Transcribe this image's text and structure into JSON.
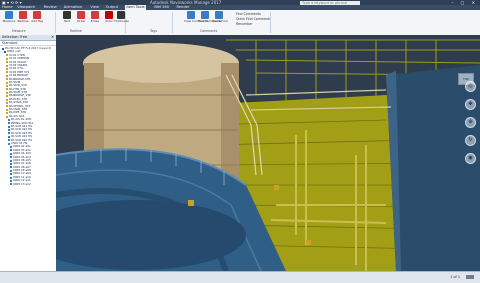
{
  "titlebar": {
    "app_title": "Autodesk Navisworks Manage 2017",
    "search_placeholder": "Type a keyword or phrase",
    "window_controls": "– ▢ ✕",
    "quick_access": "▣ ▾ ⟲ ⟳ ▾"
  },
  "tabs": [
    "Home",
    "Viewpoint",
    "Review",
    "Animation",
    "View",
    "Output",
    "Item Tools",
    "BIM 360",
    "Render"
  ],
  "active_tab": "Item Tools",
  "ribbon": {
    "buttons": [
      {
        "label": "Measure",
        "icon": "ruler-icon",
        "color": "#2c7fd1"
      },
      {
        "label": "Redline",
        "icon": "pen-icon",
        "color": "#d23b3b"
      },
      {
        "label": "Add Tag",
        "icon": "tag-icon",
        "color": "#d23b3b"
      },
      {
        "label": "View Comments",
        "icon": "comment-icon",
        "color": "#3a7ac8"
      },
      {
        "label": "Find Comments",
        "icon": "find-icon",
        "color": "#3a7ac8"
      },
      {
        "label": "Quick Find",
        "icon": "binoculars-icon",
        "color": "#3a7ac8"
      },
      {
        "label": "Text",
        "icon": "text-icon",
        "color": "#333333"
      },
      {
        "label": "Draw",
        "icon": "draw-icon",
        "color": "#d23b3b"
      },
      {
        "label": "Erase",
        "icon": "erase-icon",
        "color": "#d23b3b"
      },
      {
        "label": "Color",
        "icon": "color-icon",
        "color": "#c00000"
      },
      {
        "label": "Thickness",
        "icon": "thickness-icon",
        "color": "#333333"
      }
    ],
    "small_items": [
      "Find Comments",
      "Quick Find Comments",
      "Renumber"
    ],
    "groups": [
      "Measure",
      "Redline",
      "Tags",
      "Comments"
    ]
  },
  "panel": {
    "title": "Selection Tree",
    "mode": "Standard",
    "items": [
      "PC-HZ CAC EF Full 2017 (Level 2)",
      "0000 unit",
      "U101 CTPN",
      "V101 CMPRSN",
      "V102 STAGE",
      "V103 TRAINS",
      "V104 UTIL",
      "V105 PIPE SYS",
      "V106 BRIDGE",
      "PA-BRIDGE-STR",
      "PA SKIM",
      "PA SKID_STR",
      "PA-HTR_STR",
      "PA-SKIM_STR",
      "PA-BRIDGE_STR",
      "PA-ELEC_STR",
      "PA-STAIR_STR",
      "PA-VESSEL_STR",
      "PA-TANK_STR",
      "PA-PIPE_STR",
      "PA AIS SCR",
      "PA AIS OL SCR",
      "PIPING-400 HK1",
      "PA SCR 421 HS",
      "PA SCR 422 HS",
      "PA SCR 423 HS",
      "PA SCR 424 HS",
      "PA SCR 425 HS",
      "2300 01 HS",
      "0000 02 a01",
      "0000 03 a02",
      "0000 04 a03",
      "0000 05 a04",
      "0000 06 a05",
      "0000 07 a06",
      "0000 08 a07",
      "0000 09 a08",
      "0000 10 a09",
      "0000 11 a10",
      "0000 12 a11",
      "0000 13 a12"
    ]
  },
  "colors": {
    "steel": "#9b9c1c",
    "vessel": "#c9b48e",
    "platform": "#2f5f86",
    "background": "#2e3c4e"
  },
  "status": {
    "text": "1 of 1"
  }
}
